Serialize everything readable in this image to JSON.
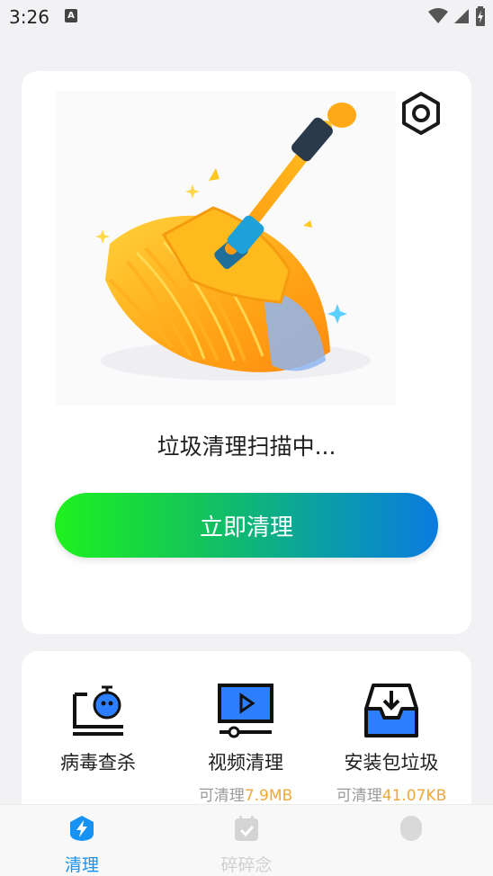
{
  "status_bar": {
    "time": "3:26",
    "notification_letter": "A"
  },
  "main_card": {
    "scan_status": "垃圾清理扫描中...",
    "clean_button": "立即清理"
  },
  "tools": [
    {
      "label": "病毒查杀"
    },
    {
      "label": "视频清理",
      "sub_prefix": "可清理",
      "sub_size": "7.9MB"
    },
    {
      "label": "安装包垃圾",
      "sub_prefix": "可清理",
      "sub_size": "41.07KB"
    }
  ],
  "nav": {
    "items": [
      {
        "label": "清理",
        "icon": "lightning-shield-icon"
      },
      {
        "label": "碎碎念",
        "icon": "calendar-check-icon"
      },
      {
        "label": "",
        "icon": "pill-icon"
      }
    ]
  },
  "colors": {
    "accent_blue": "#1592f3",
    "size_orange": "#efa83a",
    "button_gradient_start": "#1ef21e",
    "button_gradient_end": "#0a7be0"
  }
}
